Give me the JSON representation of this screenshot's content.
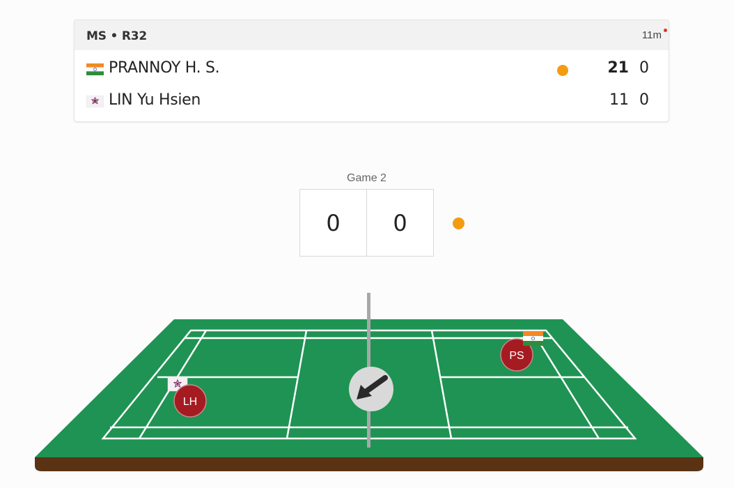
{
  "match": {
    "round": "MS • R32",
    "duration": "11m",
    "players": [
      {
        "name": "PRANNOY H. S.",
        "country_flag": "india-flag-icon",
        "game1": "21",
        "game2": "0",
        "serving": true
      },
      {
        "name": "LIN Yu Hsien",
        "country_flag": "chinese-taipei-flag-icon",
        "game1": "11",
        "game2": "0",
        "serving": false
      }
    ]
  },
  "current_game": {
    "label": "Game 2",
    "score_left": "0",
    "score_right": "0"
  },
  "court": {
    "left_player_initials": "LH",
    "right_player_initials": "PS",
    "shuttle_direction": "arrow-down-left-icon"
  },
  "colors": {
    "court_green": "#1f9353",
    "court_base": "#5a3315",
    "player_marker": "#a51b22",
    "serve_indicator": "#f39c12"
  }
}
